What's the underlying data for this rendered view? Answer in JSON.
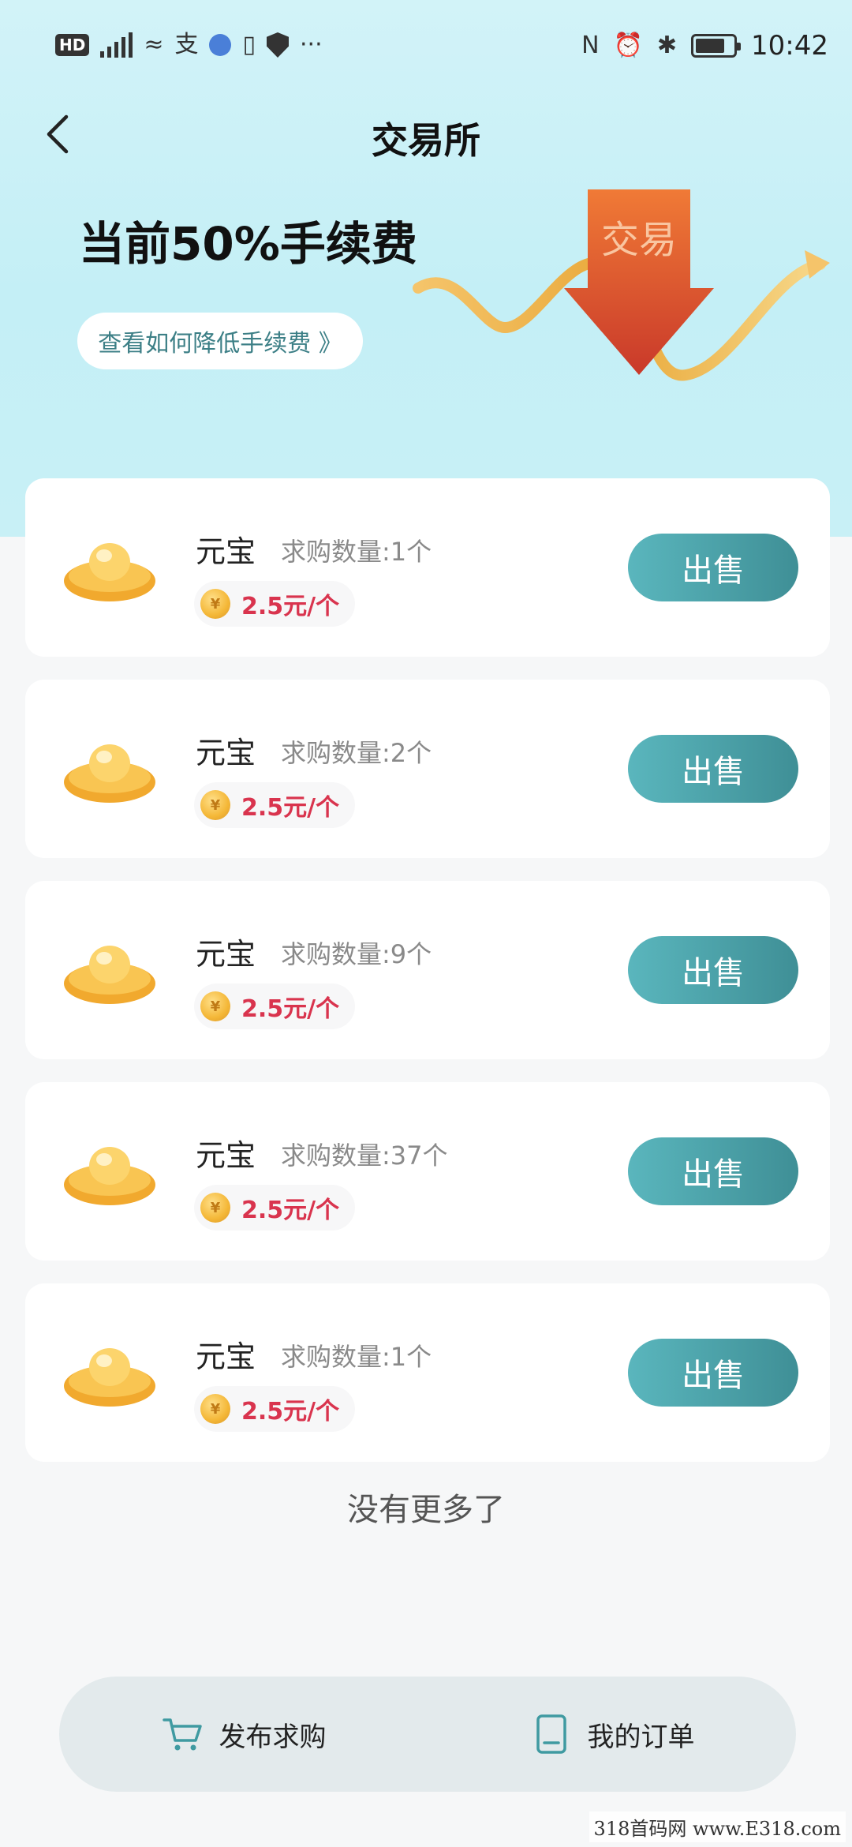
{
  "status_bar": {
    "left_icons": [
      "hd-icon",
      "5g-signal-icon",
      "wifi-icon",
      "alipay-icon",
      "browser-icon",
      "chart-app-icon",
      "shield-icon",
      "more-icon"
    ],
    "right_icons": [
      "nfc-icon",
      "alarm-icon",
      "bluetooth-icon",
      "battery-icon"
    ],
    "hd_label": "HD",
    "more": "···",
    "time": "10:42"
  },
  "header": {
    "title": "交易所",
    "fee_title": "当前50%手续费",
    "fee_link": "查看如何降低手续费 》",
    "illustration_text": "交易"
  },
  "listings": [
    {
      "name": "元宝",
      "qty": "求购数量:1个",
      "price": "2.5元/个",
      "action": "出售"
    },
    {
      "name": "元宝",
      "qty": "求购数量:2个",
      "price": "2.5元/个",
      "action": "出售"
    },
    {
      "name": "元宝",
      "qty": "求购数量:9个",
      "price": "2.5元/个",
      "action": "出售"
    },
    {
      "name": "元宝",
      "qty": "求购数量:37个",
      "price": "2.5元/个",
      "action": "出售"
    },
    {
      "name": "元宝",
      "qty": "求购数量:1个",
      "price": "2.5元/个",
      "action": "出售"
    }
  ],
  "footer_note": "没有更多了",
  "bottom_bar": {
    "publish_label": "发布求购",
    "orders_label": "我的订单"
  },
  "watermark": "318首码网 www.E318.com",
  "colors": {
    "accent": "#4fa6ad",
    "price": "#d9344e",
    "hero_bg": "#c8f0f6"
  }
}
